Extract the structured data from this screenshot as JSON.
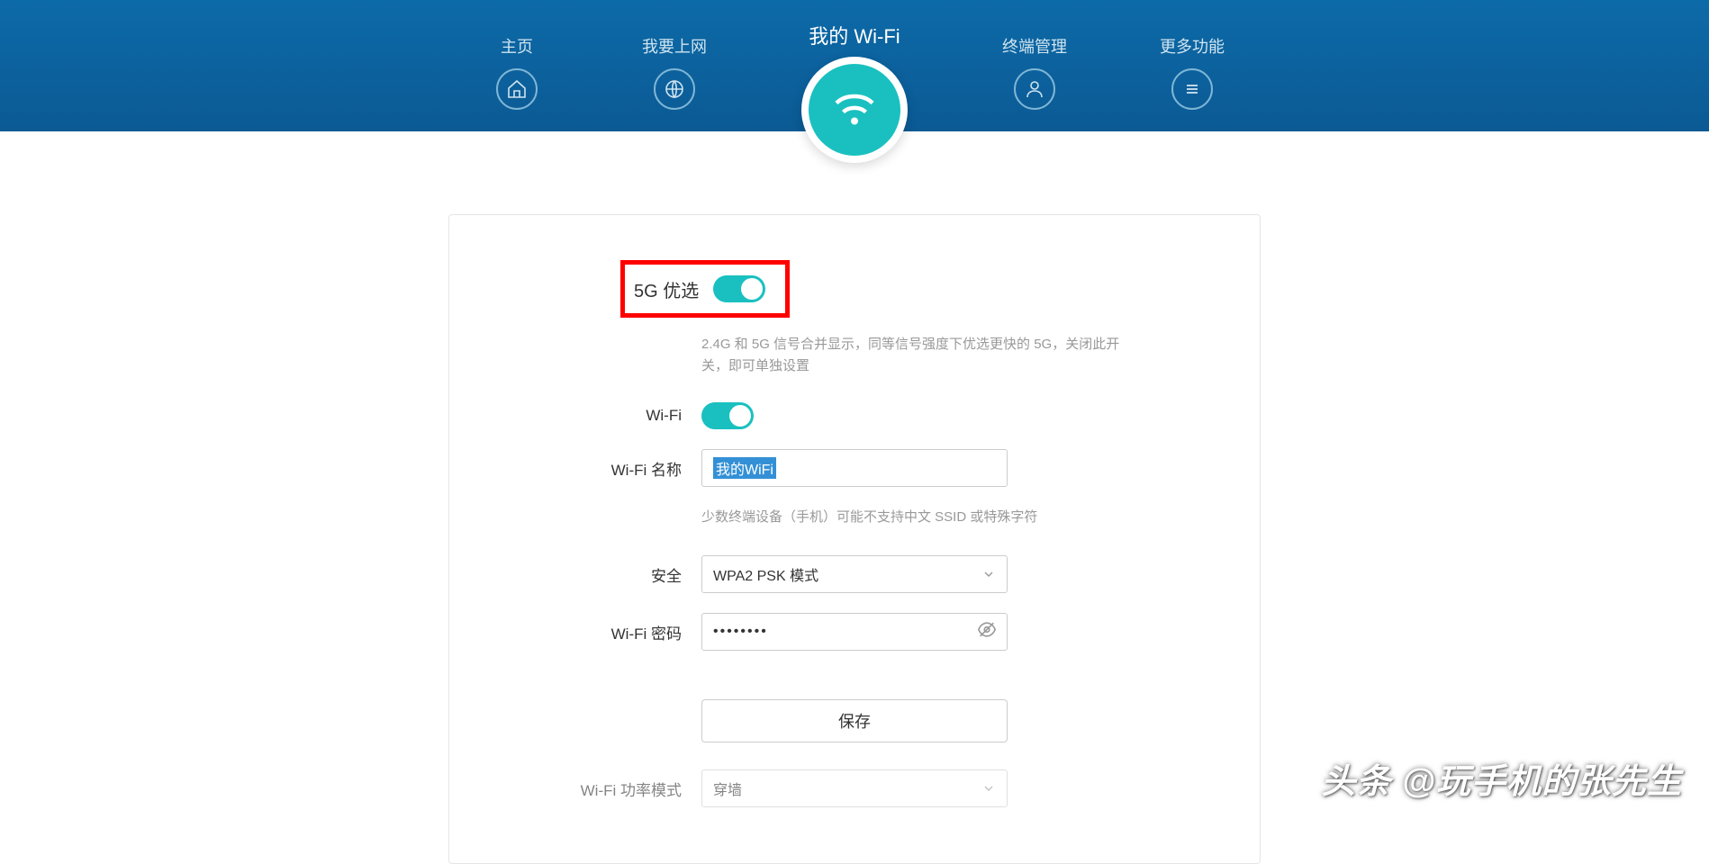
{
  "nav": {
    "home": "主页",
    "internet": "我要上网",
    "wifi": "我的 Wi-Fi",
    "devices": "终端管理",
    "more": "更多功能"
  },
  "form": {
    "priority5g_label": "5G 优选",
    "priority5g_hint": "2.4G 和 5G 信号合并显示，同等信号强度下优选更快的 5G，关闭此开关，即可单独设置",
    "wifi_label": "Wi-Fi",
    "wifi_name_label": "Wi-Fi 名称",
    "wifi_name_value": "我的WiFi",
    "wifi_name_hint": "少数终端设备（手机）可能不支持中文 SSID 或特殊字符",
    "security_label": "安全",
    "security_value": "WPA2 PSK 模式",
    "password_label": "Wi-Fi 密码",
    "password_value": "••••••••",
    "save_btn": "保存",
    "power_label": "Wi-Fi 功率模式",
    "power_value": "穿墙"
  },
  "watermark": "头条 @玩手机的张先生"
}
